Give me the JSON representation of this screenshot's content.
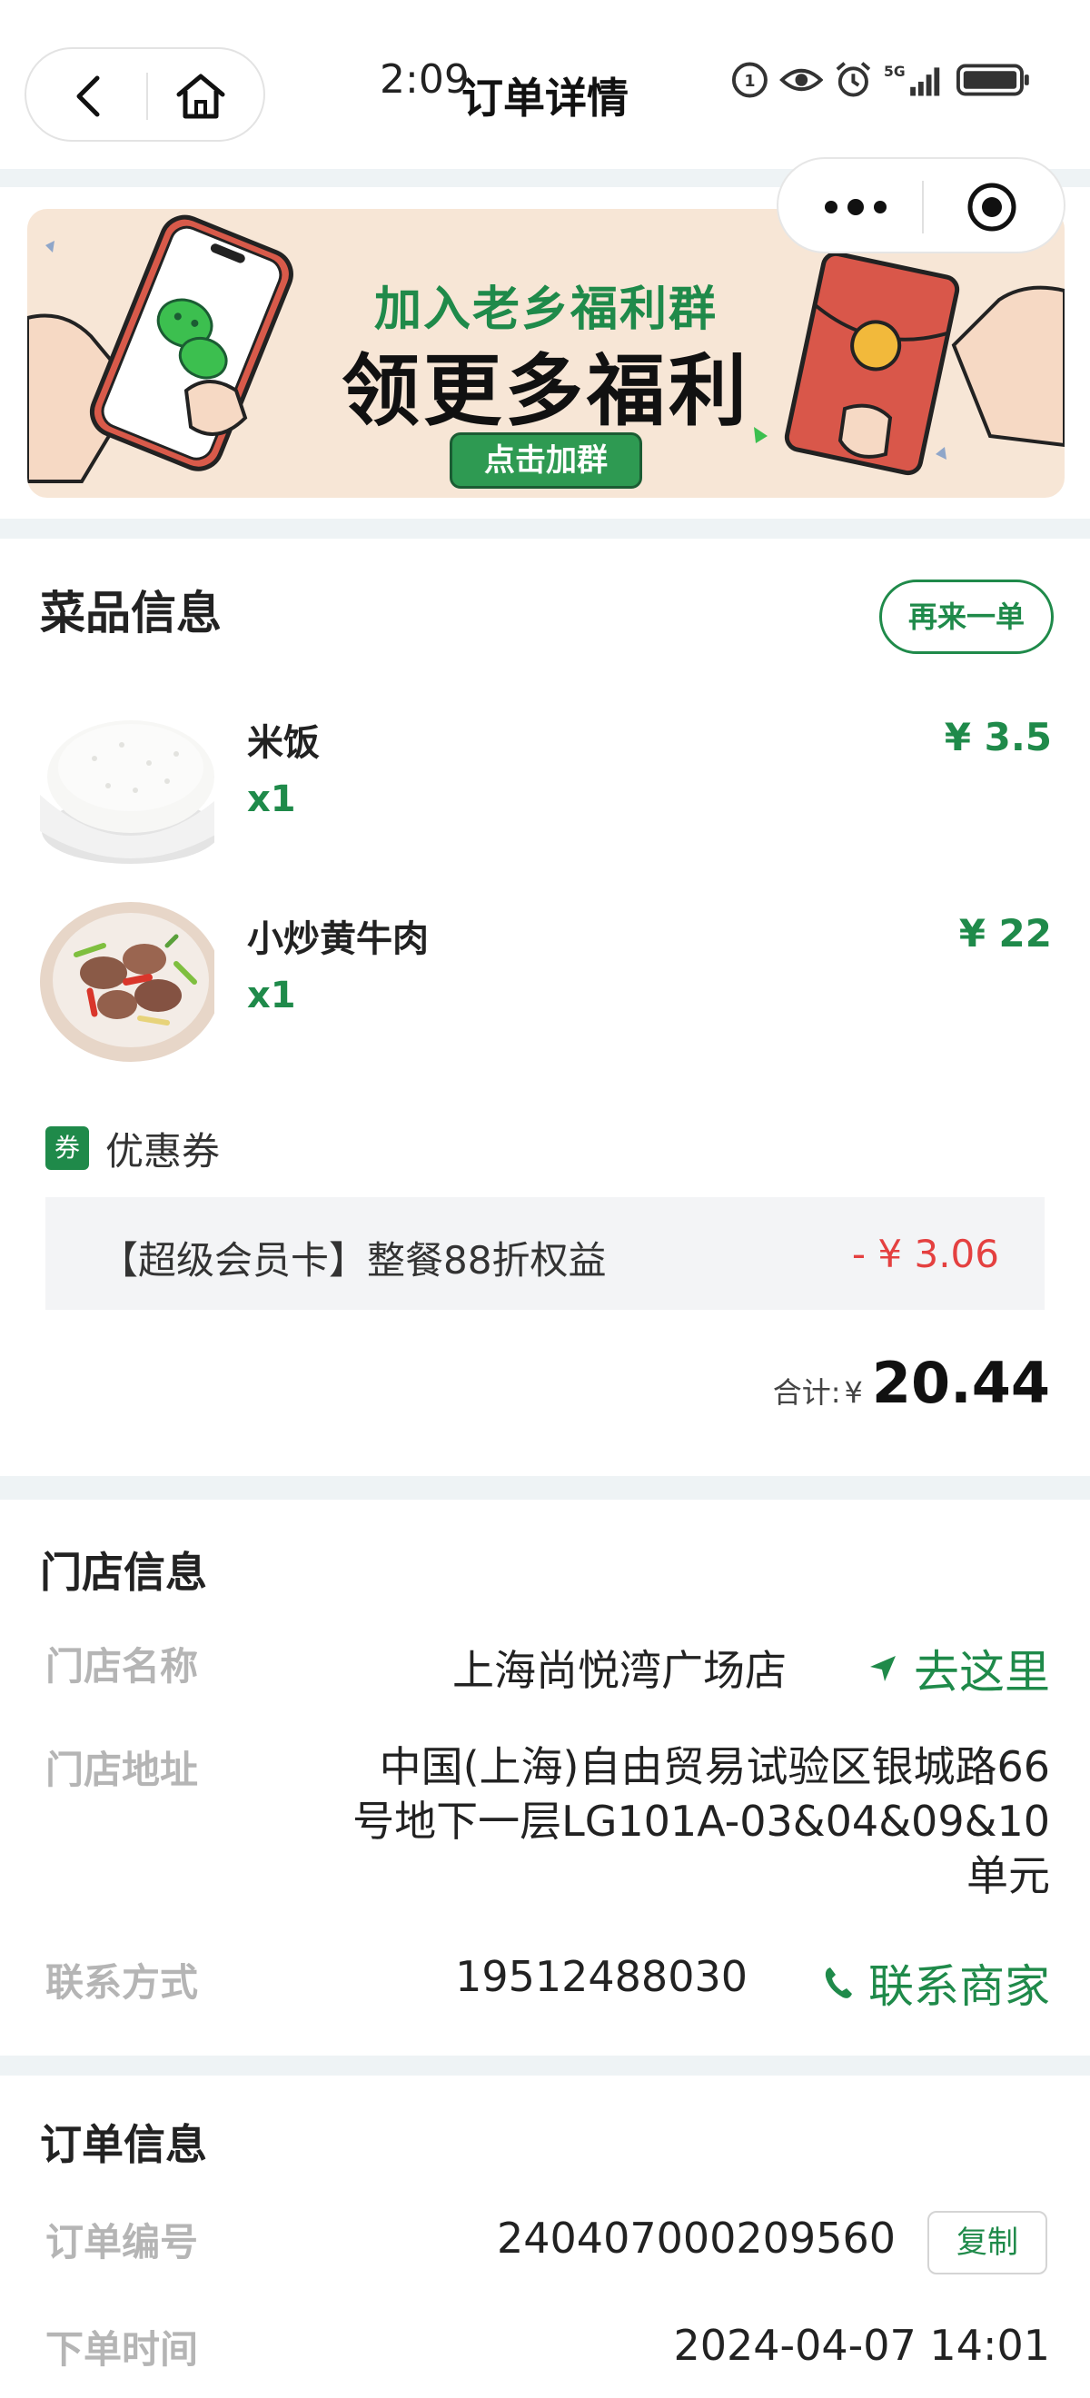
{
  "status_bar": {
    "time": "2:09"
  },
  "header": {
    "title": "订单详情"
  },
  "banner": {
    "line1": "加入老乡福利群",
    "line2": "领更多福利",
    "button": "点击加群"
  },
  "dishes": {
    "title": "菜品信息",
    "reorder_label": "再来一单",
    "items": [
      {
        "name": "米饭",
        "qty": "x1",
        "price": "¥ 3.5",
        "image": "rice-bowl"
      },
      {
        "name": "小炒黄牛肉",
        "qty": "x1",
        "price": "¥ 22",
        "image": "stir-fried-beef"
      }
    ],
    "coupon": {
      "badge": "券",
      "label": "优惠券",
      "desc": "【超级会员卡】整餐88折权益",
      "discount": "- ¥ 3.06"
    },
    "total": {
      "label": "合计:",
      "currency": "¥",
      "amount": "20.44"
    }
  },
  "store": {
    "title": "门店信息",
    "name_label": "门店名称",
    "name": "上海尚悦湾广场店",
    "nav_label": "去这里",
    "address_label": "门店地址",
    "address_line1": "中国(上海)自由贸易试验区银城路66",
    "address_line2": "号地下一层LG101A-03&04&09&10",
    "address_line3": "单元",
    "contact_label": "联系方式",
    "phone": "19512488030",
    "contact_action": "联系商家"
  },
  "order": {
    "title": "订单信息",
    "number_label": "订单编号",
    "number": "240407000209560",
    "copy_label": "复制",
    "time_label": "下单时间",
    "time": "2024-04-07 14:01"
  },
  "colors": {
    "accent": "#1f8a4a",
    "discount": "#e44040",
    "label_gray": "#b5b5b5"
  }
}
